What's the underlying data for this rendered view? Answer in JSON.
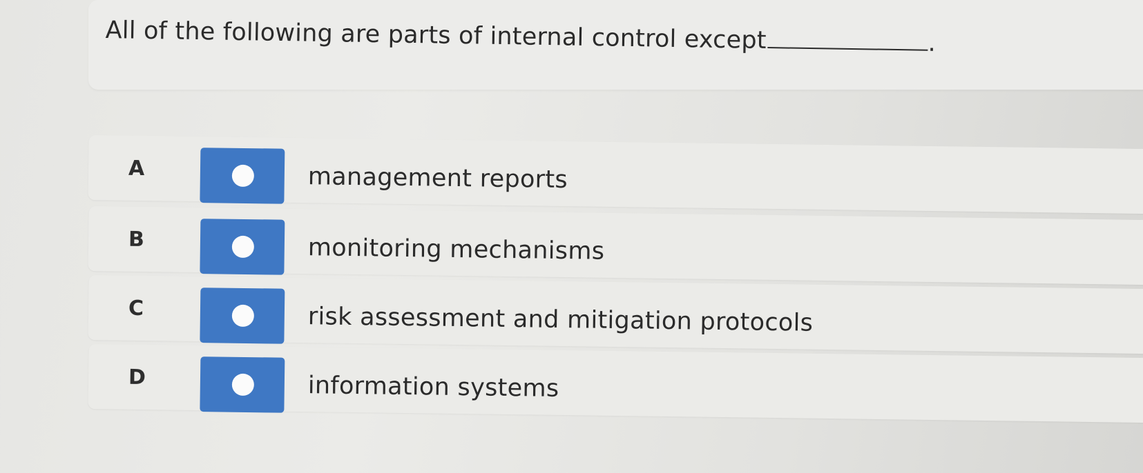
{
  "question": {
    "text": "All of the following are parts of internal control except",
    "end_punctuation": "."
  },
  "answers": [
    {
      "letter": "A",
      "text": "management reports"
    },
    {
      "letter": "B",
      "text": "monitoring mechanisms"
    },
    {
      "letter": "C",
      "text": "risk assessment and mitigation protocols"
    },
    {
      "letter": "D",
      "text": "information systems"
    }
  ],
  "colors": {
    "radio_box": "#3f78c4",
    "radio_dot": "#fbfbfb",
    "background": "#e6e6e3"
  },
  "icons": {
    "radio": "radio-button-icon"
  }
}
